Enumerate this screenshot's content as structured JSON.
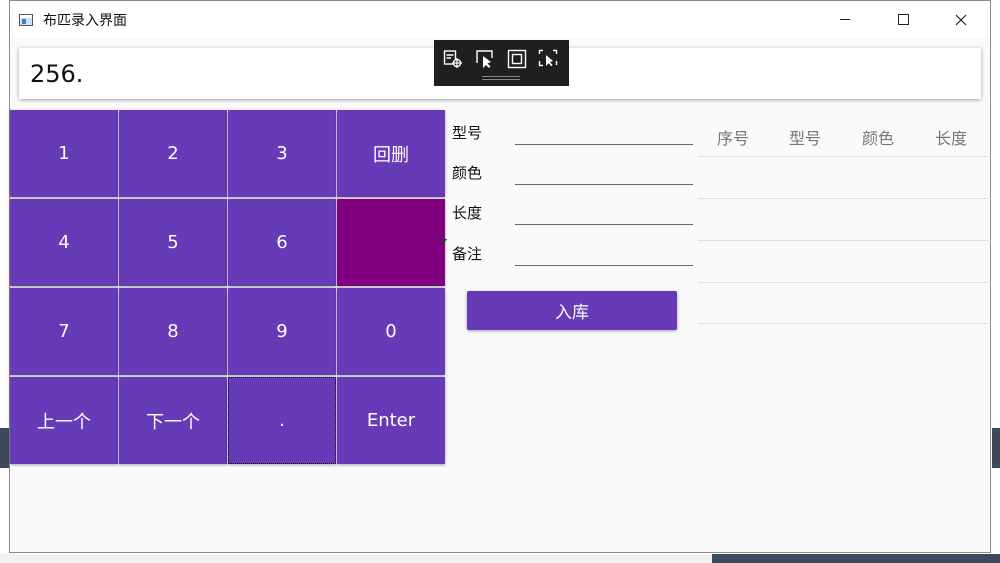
{
  "window": {
    "title": "布匹录入界面"
  },
  "display": {
    "value": "256."
  },
  "keypad": {
    "keys": [
      {
        "id": "1",
        "label": "1"
      },
      {
        "id": "2",
        "label": "2"
      },
      {
        "id": "3",
        "label": "3"
      },
      {
        "id": "backspace",
        "label": "回删"
      },
      {
        "id": "4",
        "label": "4"
      },
      {
        "id": "5",
        "label": "5"
      },
      {
        "id": "6",
        "label": "6"
      },
      {
        "id": "blank",
        "label": ""
      },
      {
        "id": "7",
        "label": "7"
      },
      {
        "id": "8",
        "label": "8"
      },
      {
        "id": "9",
        "label": "9"
      },
      {
        "id": "0",
        "label": "0"
      },
      {
        "id": "prev",
        "label": "上一个"
      },
      {
        "id": "next",
        "label": "下一个"
      },
      {
        "id": "dot",
        "label": "."
      },
      {
        "id": "enter",
        "label": "Enter"
      }
    ]
  },
  "form": {
    "model_label": "型号",
    "color_label": "颜色",
    "length_label": "长度",
    "remark_label": "备注",
    "submit_label": "入库"
  },
  "grid": {
    "columns": [
      "序号",
      "型号",
      "颜色",
      "长度"
    ]
  },
  "colors": {
    "key_bg": "#673ab7",
    "key_selected_bg": "#800080",
    "window_bg": "#fafafa"
  },
  "icons": {
    "debug_toolbar": [
      "live-tree-icon",
      "select-element-icon",
      "display-adorner-icon",
      "track-focus-icon"
    ]
  }
}
